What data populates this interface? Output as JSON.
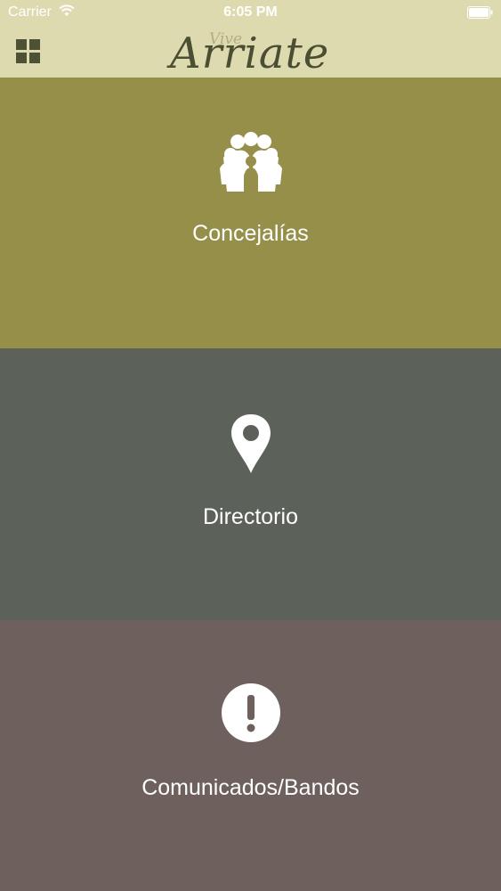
{
  "status_bar": {
    "carrier": "Carrier",
    "time": "6:05 PM",
    "wifi_icon": "wifi-icon",
    "battery_icon": "battery-icon"
  },
  "header": {
    "menu_icon": "grid-menu-icon",
    "logo_small": "Vive",
    "logo_main": "Arriate"
  },
  "sections": [
    {
      "label": "Concejalías",
      "icon": "people-group-icon",
      "color": "#958f49"
    },
    {
      "label": "Directorio",
      "icon": "map-pin-icon",
      "color": "#5c615a"
    },
    {
      "label": "Comunicados/Bandos",
      "icon": "alert-circle-icon",
      "color": "#6e605d"
    }
  ],
  "colors": {
    "header_bg": "#dedab0",
    "logo_text": "#4a4e32",
    "label_text": "#ffffff"
  }
}
